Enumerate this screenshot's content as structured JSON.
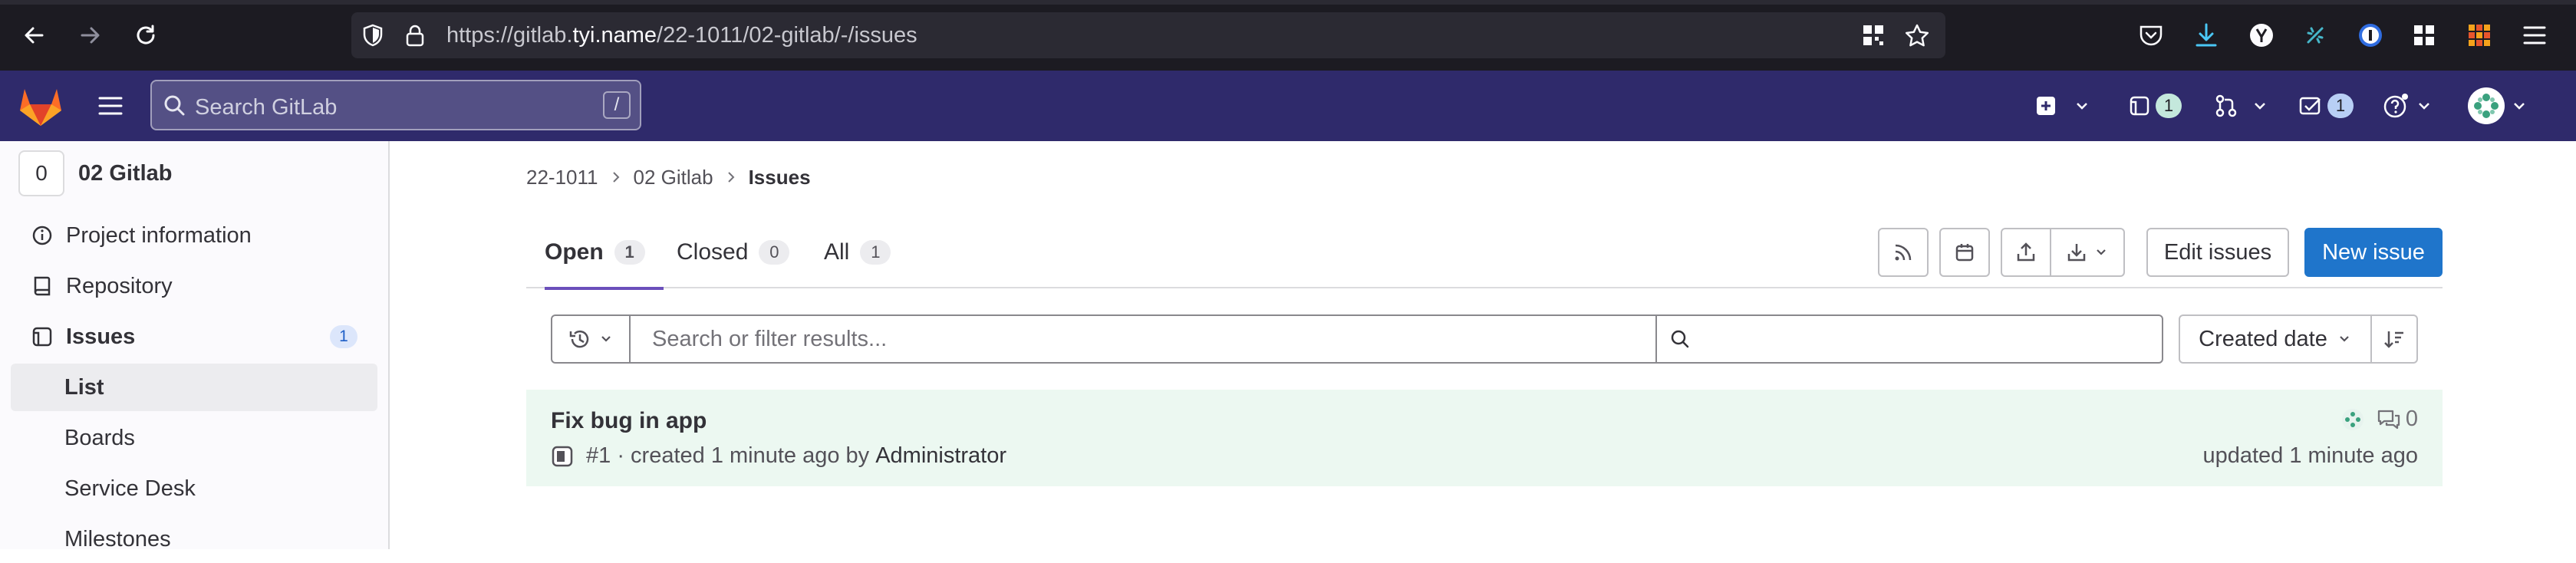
{
  "browser": {
    "url_prefix": "https://gitlab.",
    "url_domain": "tyi.name",
    "url_path": "/22-1011/02-gitlab/-/issues"
  },
  "header": {
    "search_placeholder": "Search GitLab",
    "search_shortcut": "/",
    "issues_count": "1",
    "todos_count": "1"
  },
  "sidebar": {
    "project_initial": "0",
    "project_name": "02 Gitlab",
    "items": [
      {
        "label": "Project information",
        "icon": "info-icon"
      },
      {
        "label": "Repository",
        "icon": "book-icon"
      },
      {
        "label": "Issues",
        "icon": "issues-icon",
        "badge": "1"
      },
      {
        "label": "List"
      },
      {
        "label": "Boards"
      },
      {
        "label": "Service Desk"
      },
      {
        "label": "Milestones"
      }
    ]
  },
  "breadcrumb": [
    "22-1011",
    "02 Gitlab",
    "Issues"
  ],
  "tabs": [
    {
      "label": "Open",
      "count": "1"
    },
    {
      "label": "Closed",
      "count": "0"
    },
    {
      "label": "All",
      "count": "1"
    }
  ],
  "actions": {
    "edit_issues": "Edit issues",
    "new_issue": "New issue"
  },
  "filter": {
    "placeholder": "Search or filter results...",
    "sort_label": "Created date"
  },
  "issues": [
    {
      "title": "Fix bug in app",
      "ref": "#1",
      "created": " · created 1 minute ago by",
      "author": "Administrator",
      "comments": "0",
      "updated": "updated 1 minute ago"
    }
  ]
}
